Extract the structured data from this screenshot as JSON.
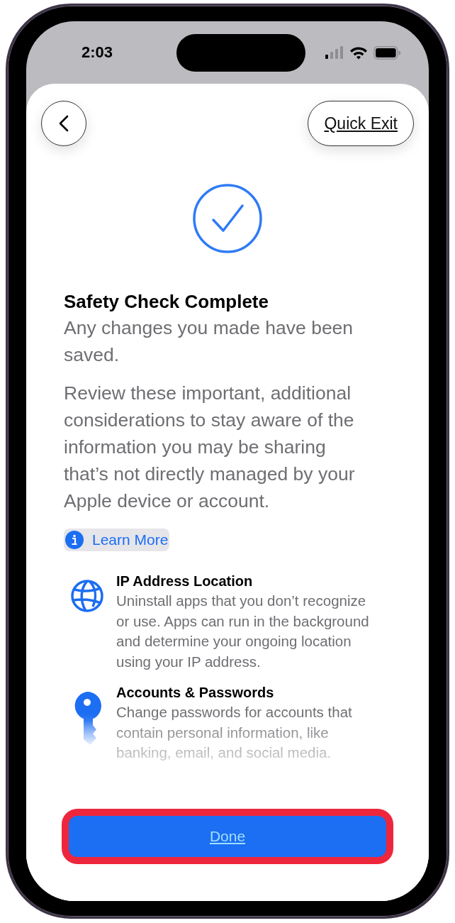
{
  "status_bar": {
    "time": "2:03"
  },
  "quick_exit": "Quick Exit",
  "title": "Safety Check Complete",
  "subtitle": "Any changes you made have been saved.",
  "description": "Review these important, additional considerations to stay aware of the information you may be sharing that’s not directly managed by your Apple device or account.",
  "learn_more": "Learn More",
  "items": [
    {
      "kind": "globe",
      "title": "IP Address Location",
      "body": "Uninstall apps that you don’t recognize or use. Apps can run in the background and determine your ongoing location using your IP address."
    },
    {
      "kind": "key",
      "title": "Accounts & Passwords",
      "body": "Change passwords for accounts that contain personal information, like banking, email, and social media."
    }
  ],
  "done": {
    "label": "Done",
    "highlighted": true
  }
}
